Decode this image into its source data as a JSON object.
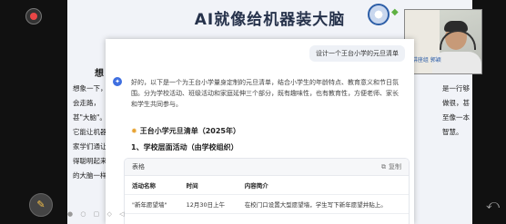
{
  "slide": {
    "title": "AI就像给机器装大脑",
    "left_heading": "想",
    "left_text": "想象一下，会走路，甚\"大脑\"。它能让机器家学们通让得聪明起来的大脑一样",
    "right_text": "是一行够做很，甚至像一本智慧。"
  },
  "participant": {
    "label": "AI讲座组 郭颖"
  },
  "chat": {
    "user_message": "设计一个王台小学的元旦清单",
    "ai_avatar": "✦",
    "answer_text": "好的，以下是一个为王台小学量身定制的元旦清单，结合小学生的年龄特点、教育意义和节日氛围。分为学校活动、班级活动和家庭延伸三个部分，既有趣味性，也有教育性，方便老师、家长和学生共同参与。",
    "list_title": "王台小学元旦清单（2025年）",
    "list_title_icon": "star-icon",
    "section_title": "1、学校层面活动（由学校组织）",
    "table": {
      "label": "表格",
      "copy_label": "复制",
      "columns": [
        "活动名称",
        "时间",
        "内容简介"
      ],
      "rows": [
        [
          "\"新年愿望墙\"",
          "12月30日上午",
          "在校门口设置大型愿望墙，学生写下新年愿望并贴上。"
        ]
      ]
    }
  },
  "controls": {
    "mic_icon": "mic-icon",
    "record_icon": "record-icon",
    "back_icon": "back-icon"
  }
}
